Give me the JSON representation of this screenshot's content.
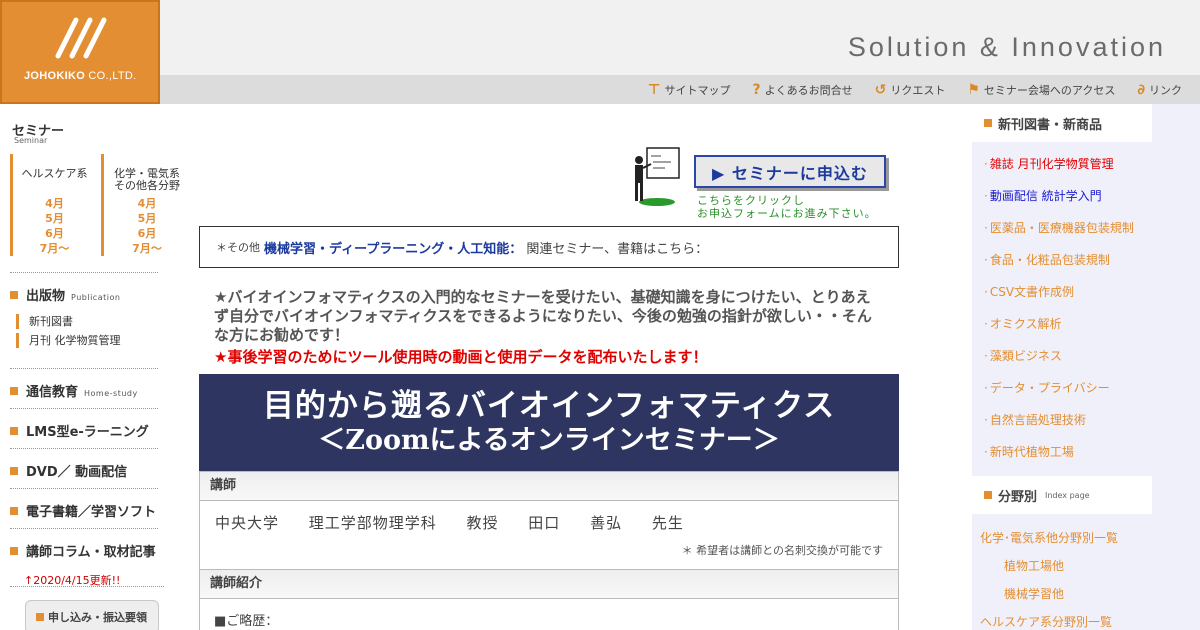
{
  "header": {
    "logo_brand": "JOHOKIKO",
    "logo_suffix": " CO.,LTD.",
    "slogan": "Solution & Innovation",
    "nav": [
      {
        "label": "サイトマップ",
        "icon": "signpost-icon"
      },
      {
        "label": "よくあるお問合せ",
        "icon": "question-icon"
      },
      {
        "label": "リクエスト",
        "icon": "request-icon"
      },
      {
        "label": "セミナー会場へのアクセス",
        "icon": "flag-icon"
      },
      {
        "label": "リンク",
        "icon": "link-icon"
      }
    ]
  },
  "left": {
    "seminar_title": "セミナー",
    "seminar_sub": "Seminar",
    "col1": {
      "head": "ヘルスケア系",
      "months": [
        "4月",
        "5月",
        "6月",
        "7月～"
      ]
    },
    "col2": {
      "head1": "化学・電気系",
      "head2": "その他各分野",
      "months": [
        "4月",
        "5月",
        "6月",
        "7月～"
      ]
    },
    "publication": {
      "title": "出版物",
      "en": "Publication",
      "items": [
        "新刊図書",
        "月刊 化学物質管理"
      ]
    },
    "home_study": {
      "title": "通信教育",
      "en": "Home-study"
    },
    "lms": {
      "title": "LMS型e-ラーニング"
    },
    "dvd": {
      "title": "DVD／ 動画配信"
    },
    "ebook": {
      "title": "電子書籍／学習ソフト"
    },
    "column": {
      "title": "講師コラム・取材記事"
    },
    "update_note": "↑2020/4/15更新!!",
    "apply_label": "申し込み・振込要領"
  },
  "main": {
    "cta_label": "▶ セミナーに申込む",
    "cta_note1": "こちらをクリックし",
    "cta_note2": "お申込フォームにお進み下さい。",
    "related_prefix": "＊その他",
    "related_link": "機械学習・ディープラーニング・人工知能：",
    "related_suffix": "関連セミナー、書籍はこちら：",
    "intro": "★バイオインフォマティクスの入門的なセミナーを受けたい、基礎知識を身につけたい、とりあえず自分でバイオインフォマティクスをできるようになりたい、今後の勉強の指針が欲しい・・そんな方にお勧めです！",
    "intro_red": "★事後学習のためにツール使用時の動画と使用データを配布いたします！",
    "course_title1": "目的から遡るバイオインフォマティクス",
    "course_title2": "＜Zoomによるオンラインセミナー＞",
    "lecturer_head": "講師",
    "lecturer_name": "中央大学　 理工学部物理学科　 教授　 田口　 善弘　 先生",
    "lecturer_note": "＊ 希望者は講師との名刺交換が可能です",
    "intro_head": "講師紹介",
    "career": "■ご略歴："
  },
  "right": {
    "new_title": "新刊図書・新商品",
    "new_items": [
      {
        "label": "雑誌 月刊化学物質管理",
        "color": "#e00000"
      },
      {
        "label": "動画配信 統計学入門",
        "color": "#1a1ad0"
      },
      {
        "label": "医薬品・医療機器包装規制",
        "color": "#e38e32"
      },
      {
        "label": "食品・化粧品包装規制",
        "color": "#e38e32"
      },
      {
        "label": "CSV文書作成例",
        "color": "#e38e32"
      },
      {
        "label": "オミクス解析",
        "color": "#e38e32"
      },
      {
        "label": "藻類ビジネス",
        "color": "#e38e32"
      },
      {
        "label": "データ・プライバシー",
        "color": "#e38e32"
      },
      {
        "label": "自然言語処理技術",
        "color": "#e38e32"
      },
      {
        "label": "新時代植物工場",
        "color": "#e38e32"
      }
    ],
    "cat_title": "分野別",
    "cat_en": "Index page",
    "cat_items": [
      {
        "label": "化学･電気系他分野別一覧",
        "sub": false
      },
      {
        "label": "植物工場他",
        "sub": true
      },
      {
        "label": "機械学習他",
        "sub": true
      },
      {
        "label": "ヘルスケア系分野別一覧",
        "sub": false
      }
    ]
  }
}
